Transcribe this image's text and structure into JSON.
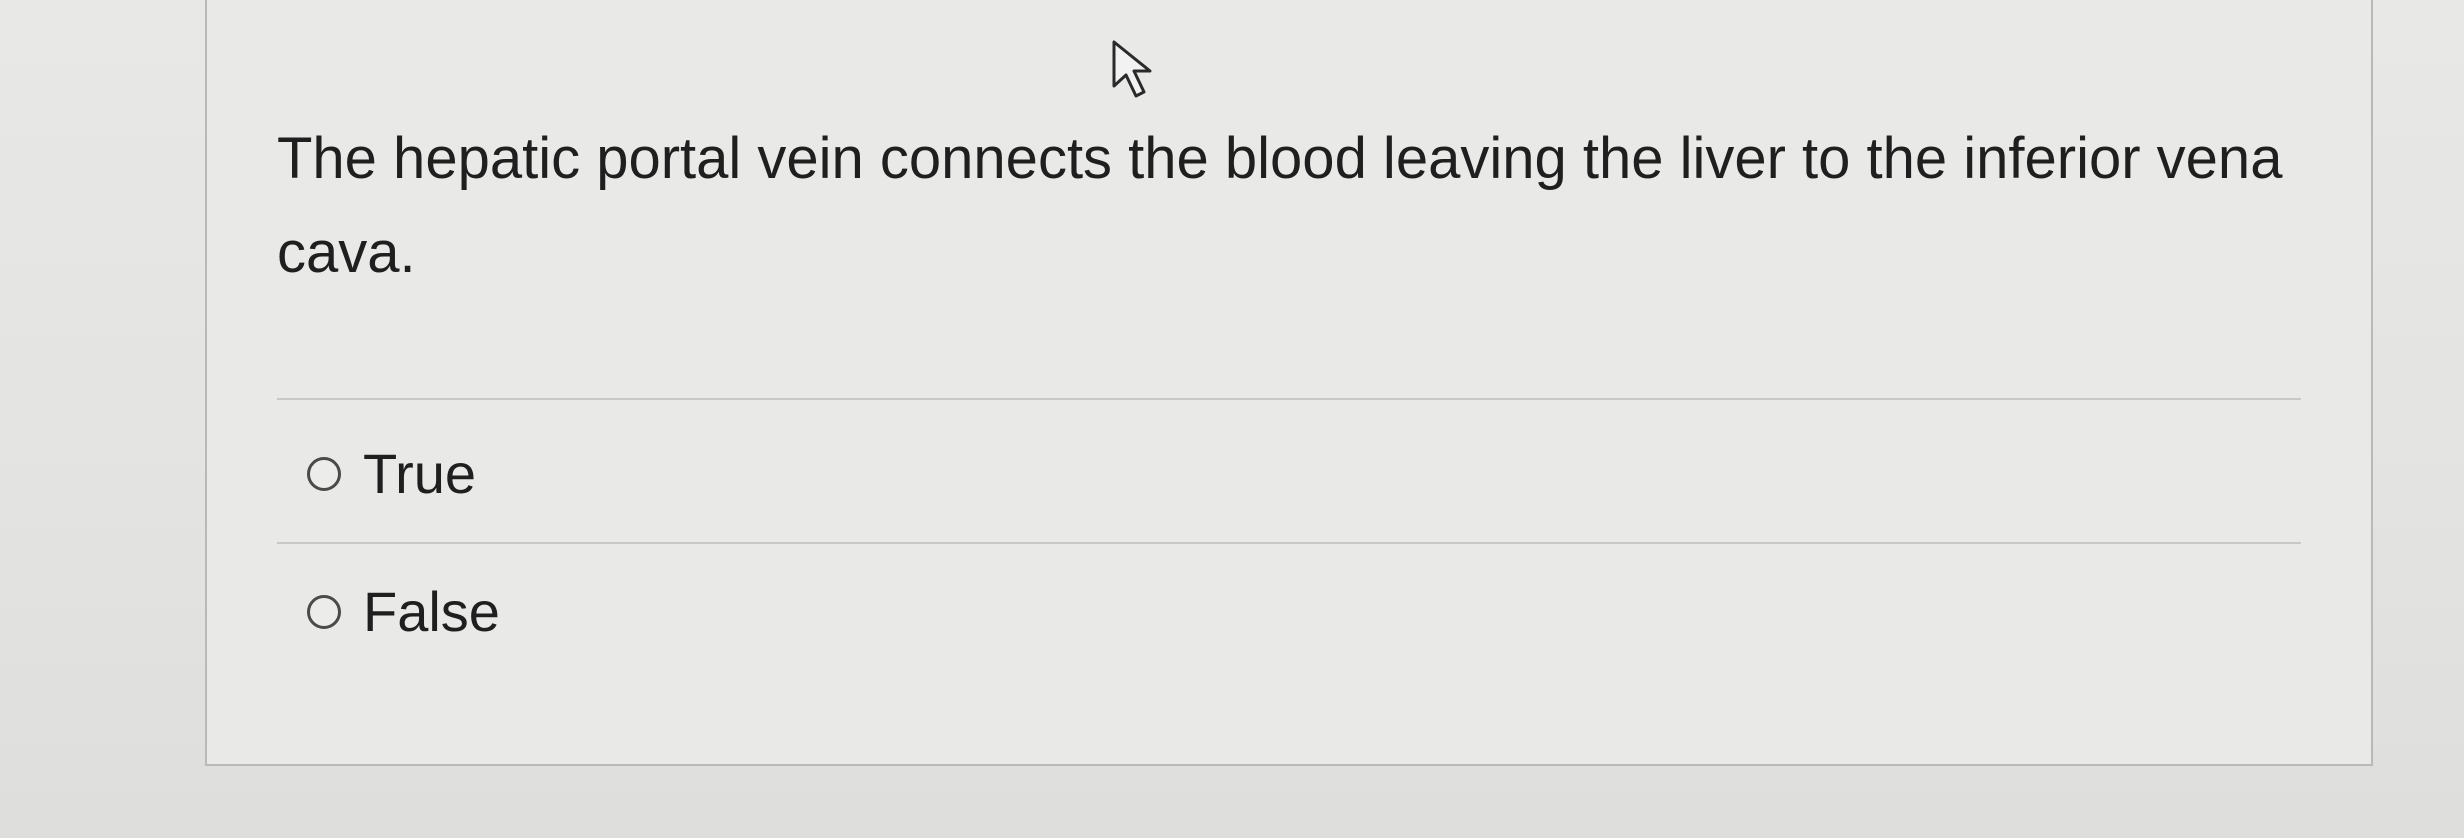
{
  "question": {
    "text": "The hepatic portal vein connects the blood leaving the liver to the inferior vena cava."
  },
  "options": [
    {
      "label": "True",
      "selected": false
    },
    {
      "label": "False",
      "selected": false
    }
  ],
  "icons": {
    "cursor": "mouse-pointer-icon",
    "radio": "radio-unselected-icon"
  },
  "colors": {
    "background": "#e4e4e2",
    "text": "#1f1f1f",
    "border": "#b9b9b7"
  }
}
